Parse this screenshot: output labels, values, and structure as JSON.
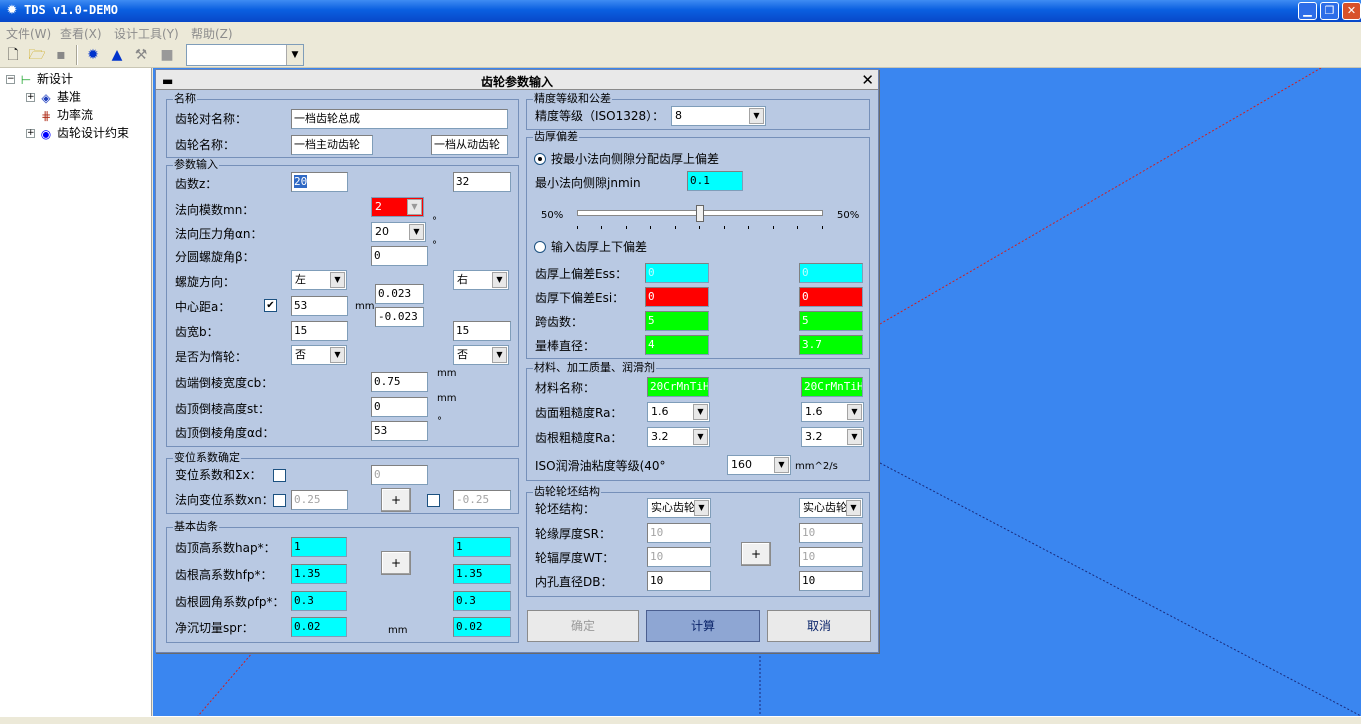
{
  "window": {
    "title": "TDS v1.0-DEMO"
  },
  "menu": [
    "文件(W)",
    "查看(X)",
    "设计工具(Y)",
    "帮助(Z)"
  ],
  "tree": {
    "root": "新设计",
    "children": [
      "基准",
      "功率流",
      "齿轮设计约束"
    ]
  },
  "dialog": {
    "title": "齿轮参数输入",
    "name_group": {
      "title": "名称",
      "pair_name_label": "齿轮对名称：",
      "pair_name": "一档齿轮总成",
      "gear_name_label": "齿轮名称：",
      "gear1_name": "一档主动齿轮",
      "gear2_name": "一档从动齿轮"
    },
    "params": {
      "title": "参数输入",
      "teeth_label": "齿数z：",
      "z1": "20",
      "z2": "32",
      "module_label": "法向模数mn：",
      "module": "2",
      "pressure_label": "法向压力角αn：",
      "pressure": "20",
      "degree": "°",
      "helix_label": "分圆螺旋角β：",
      "helix": "0",
      "hand_label": "螺旋方向：",
      "hand1": "左",
      "hand2": "右",
      "center_label": "中心距a：",
      "center": "53",
      "center_checked": "✔",
      "mm": "mm",
      "tol_upper": "0.023",
      "tol_lower": "-0.023",
      "width_label": "齿宽b：",
      "b1": "15",
      "b2": "15",
      "idler_label": "是否为惰轮：",
      "idler1": "否",
      "idler2": "否",
      "cb_label": "齿端倒棱宽度cb：",
      "cb": "0.75",
      "st_label": "齿顶倒棱高度st：",
      "st": "0",
      "ad_label": "齿顶倒棱角度αd：",
      "ad": "53"
    },
    "shift": {
      "title": "变位系数确定",
      "sum_label": "变位系数和Σx：",
      "sum": "0",
      "xn_label": "法向变位系数xn：",
      "xn1": "0.25",
      "xn2": "-0.25",
      "plus": "+"
    },
    "rack": {
      "title": "基本齿条",
      "hap_label": "齿顶高系数hap*：",
      "hap1": "1",
      "hap2": "1",
      "hfp_label": "齿根高系数hfp*：",
      "hfp1": "1.35",
      "hfp2": "1.35",
      "rho_label": "齿根圆角系数ρfp*：",
      "rho1": "0.3",
      "rho2": "0.3",
      "spr_label": "净沉切量spr：",
      "spr1": "0.02",
      "spr2": "0.02",
      "mm": "mm",
      "plus": "+"
    },
    "accuracy": {
      "title": "精度等级和公差",
      "grade_label": "精度等级（ISO1328）：",
      "grade": "8"
    },
    "thickness": {
      "title": "齿厚偏差",
      "opt1": "按最小法向侧隙分配齿厚上偏差",
      "jn_label": "最小法向侧隙jnmin",
      "jn": "0.1",
      "pct_left": "50%",
      "pct_right": "50%",
      "opt2": "输入齿厚上下偏差",
      "ess_label": "齿厚上偏差Ess：",
      "ess1": "0",
      "ess2": "0",
      "esi_label": "齿厚下偏差Esi：",
      "esi1": "0",
      "esi2": "0",
      "span_label": "跨齿数：",
      "span1": "5",
      "span2": "5",
      "ball_label": "量棒直径：",
      "ball1": "4",
      "ball2": "3.7",
      "slider_fraction": 0.5
    },
    "material": {
      "title": "材料、加工质量、润滑剂",
      "name_label": "材料名称：",
      "mat1": "20CrMnTiH",
      "mat2": "20CrMnTiH",
      "ra_label": "齿面粗糙度Ra：",
      "ra1": "1.6",
      "ra2": "1.6",
      "rz_label": "齿根粗糙度Ra：",
      "rz1": "3.2",
      "rz2": "3.2",
      "oil_label": "ISO润滑油粘度等级(40°",
      "oil": "160",
      "oil_unit": "mm^2/s"
    },
    "blank": {
      "title": "齿轮轮坯结构",
      "type_label": "轮坯结构：",
      "type1": "实心齿轮",
      "type2": "实心齿轮",
      "sr_label": "轮缘厚度SR：",
      "sr1": "10",
      "sr2": "10",
      "wt_label": "轮辐厚度WT：",
      "wt1": "10",
      "wt2": "10",
      "db_label": "内孔直径DB：",
      "db1": "10",
      "db2": "10",
      "plus": "+"
    },
    "buttons": {
      "ok": "确定",
      "calc": "计算",
      "cancel": "取消"
    }
  },
  "colors": {
    "canvas": "#3a86f0",
    "dialog": "#b9c9e3",
    "cyan": "#00ffff",
    "red": "#ff0000",
    "green": "#00ff00"
  }
}
